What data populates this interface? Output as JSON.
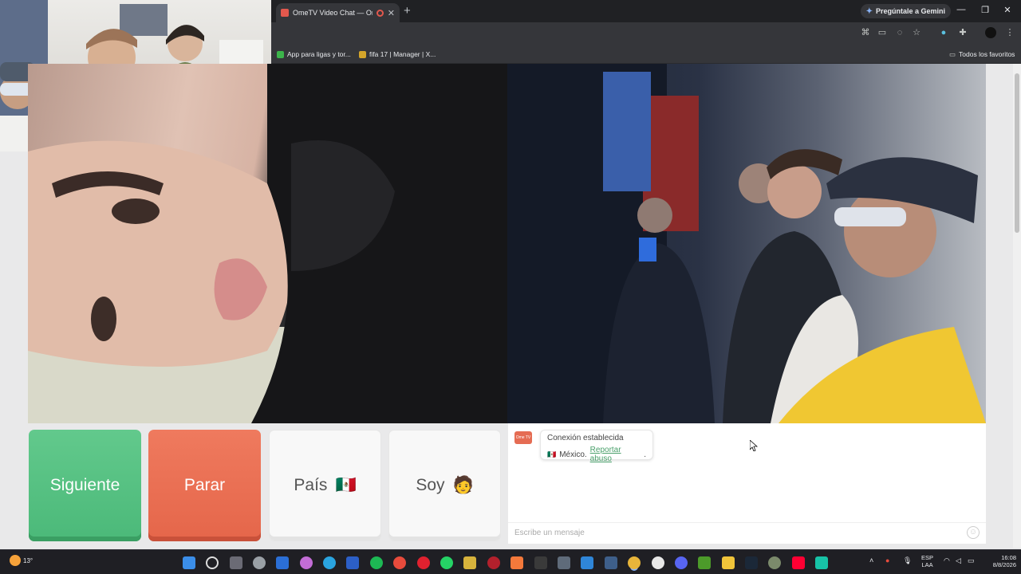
{
  "browser": {
    "tab_title": "OmeTV Video Chat — Omegle",
    "new_tab": "+",
    "gemini_label": "Pregúntale a Gemini",
    "bookmarks": [
      {
        "label": "App para ligas y tor..."
      },
      {
        "label": "fifa 17 | Manager | X..."
      }
    ],
    "bookmarks_folder": "Todos los favoritos"
  },
  "controls": {
    "next_label": "Siguiente",
    "stop_label": "Parar",
    "country_label": "País",
    "iam_label": "Soy",
    "country_flag": "🇲🇽",
    "iam_emoji": "🧑"
  },
  "chat": {
    "logo_text": "Ome TV",
    "status": "Conexión establecida",
    "country": "México.",
    "report_link": "Reportar abuso",
    "report_suffix": ".",
    "placeholder": "Escribe un mensaje"
  },
  "taskbar": {
    "weather": "13°",
    "lang_line1": "ESP",
    "lang_line2": "LAA",
    "time": "16:08",
    "date": "8/8/2026"
  },
  "colors": {
    "next": "#4bb979",
    "stop": "#e5664a",
    "link": "#4aa06b",
    "browser_dark": "#202124"
  }
}
